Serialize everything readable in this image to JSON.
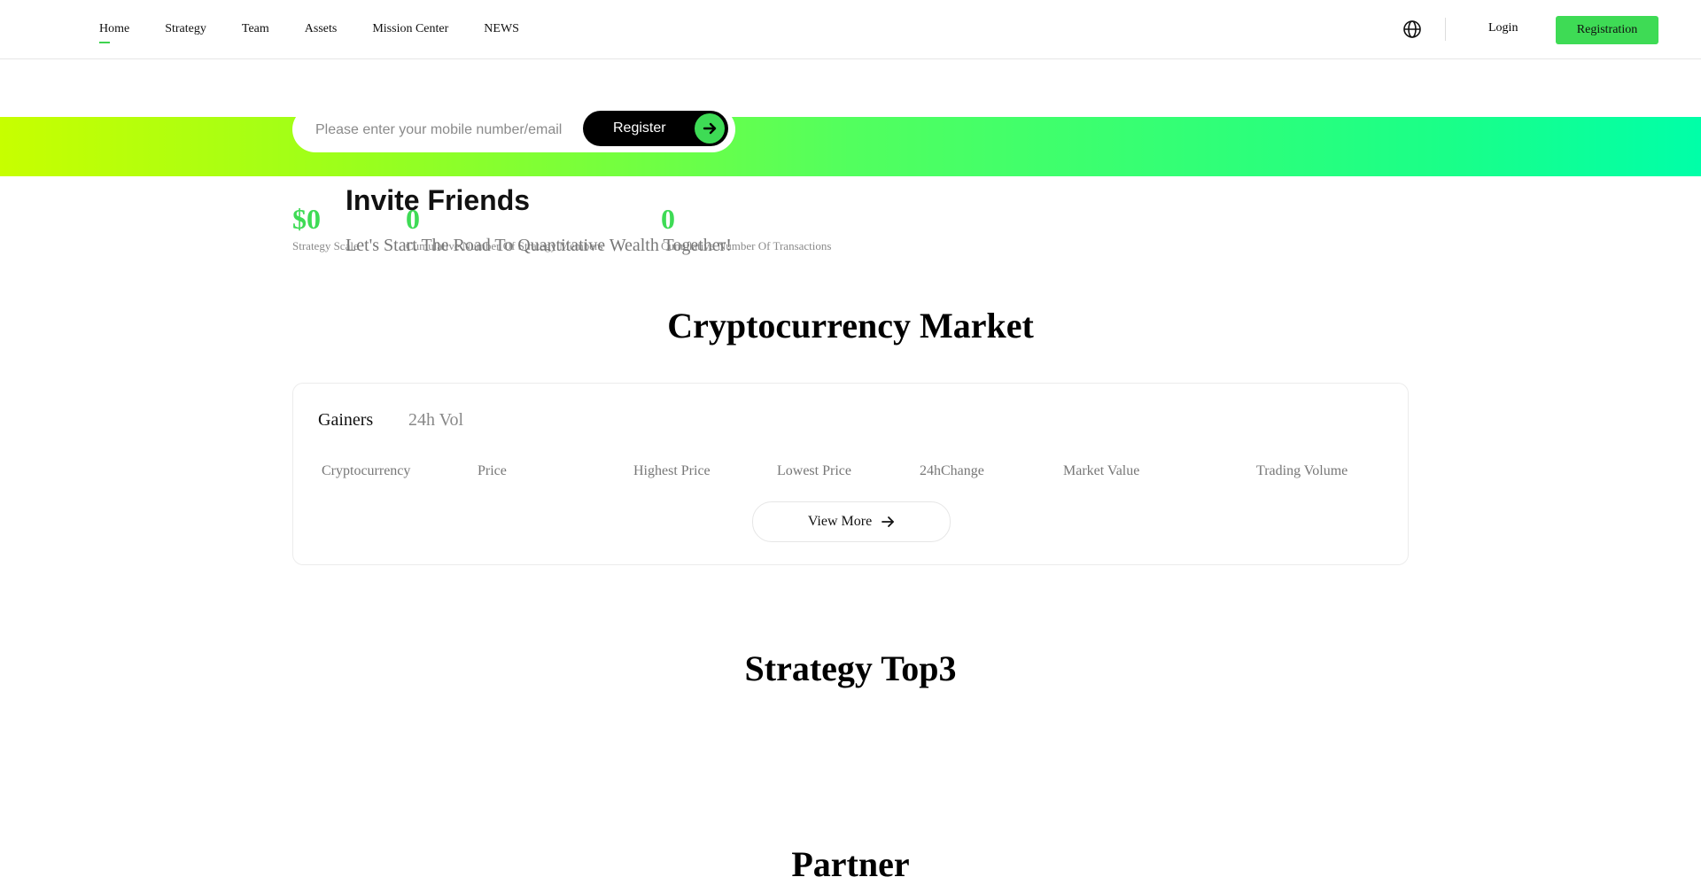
{
  "header": {
    "nav": [
      {
        "label": "Home",
        "active": true
      },
      {
        "label": "Strategy"
      },
      {
        "label": "Team"
      },
      {
        "label": "Assets"
      },
      {
        "label": "Mission Center"
      },
      {
        "label": "NEWS"
      }
    ],
    "language_icon": "globe-icon",
    "login_label": "Login",
    "registration_label": "Registration"
  },
  "register_form": {
    "placeholder": "Please enter your mobile number/email",
    "button_label": "Register",
    "button_icon": "arrow-right-icon"
  },
  "stats": [
    {
      "value": "$0",
      "label": "Strategy Scale"
    },
    {
      "value": "0",
      "label": "Cumulative Number Of Strategy Members"
    },
    {
      "value": "0",
      "label": "Cumulative Number Of Transactions"
    }
  ],
  "invite": {
    "title": "Invite Friends",
    "subtitle": "Let's Start The Road To Quantitative Wealth Together!"
  },
  "market": {
    "title": "Cryptocurrency Market",
    "tabs": [
      {
        "label": "Gainers",
        "active": true
      },
      {
        "label": "24h Vol",
        "active": false
      }
    ],
    "columns": [
      "Cryptocurrency",
      "Price",
      "Highest Price",
      "Lowest Price",
      "24hChange",
      "Market Value",
      "Trading Volume"
    ],
    "view_more_label": "View More",
    "view_more_icon": "arrow-right-icon"
  },
  "strategy": {
    "title": "Strategy Top3"
  },
  "partner": {
    "title": "Partner"
  },
  "colors": {
    "accent": "#3edb55",
    "band_start": "#c7ff00",
    "band_end": "#00ffa8"
  }
}
